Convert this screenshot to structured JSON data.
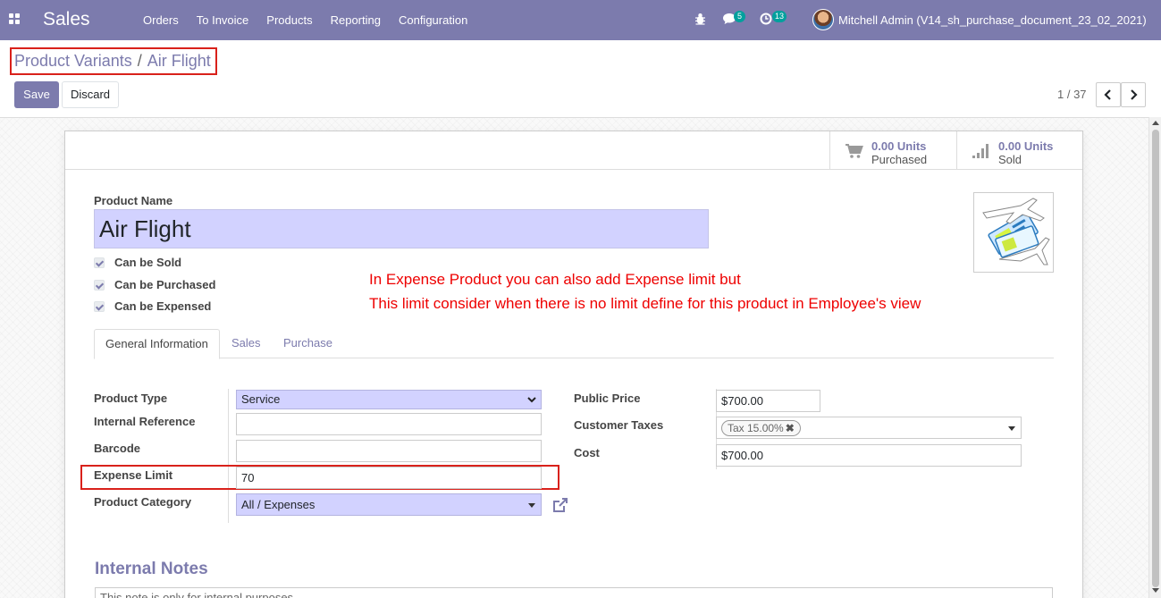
{
  "navbar": {
    "brand": "Sales",
    "menu": [
      "Orders",
      "To Invoice",
      "Products",
      "Reporting",
      "Configuration"
    ],
    "messages_badge": "5",
    "activities_badge": "13",
    "user_name": "Mitchell Admin (V14_sh_purchase_document_23_02_2021)",
    "icons": [
      "apps-grid-icon",
      "bug-icon",
      "chat-icon",
      "clock-icon"
    ]
  },
  "control_panel": {
    "breadcrumb_parent": "Product Variants",
    "breadcrumb_separator": "/",
    "breadcrumb_current": "Air Flight",
    "save_label": "Save",
    "discard_label": "Discard",
    "pager": "1 / 37",
    "prev_icon": "‹",
    "next_icon": "›"
  },
  "stat_buttons": [
    {
      "value": "0.00 Units",
      "label": "Purchased",
      "icon": "cart-icon"
    },
    {
      "value": "0.00 Units",
      "label": "Sold",
      "icon": "bar-chart-icon"
    }
  ],
  "form": {
    "product_name_label": "Product Name",
    "product_name": "Air Flight",
    "checkboxes": [
      {
        "label": "Can be Sold",
        "checked": true
      },
      {
        "label": "Can be Purchased",
        "checked": true
      },
      {
        "label": "Can be Expensed",
        "checked": true
      }
    ],
    "annotation_line1": "In Expense Product you can also add Expense limit but",
    "annotation_line2": "This limit consider when there is no limit define for this product in Employee's view",
    "tabs": [
      "General Information",
      "Sales",
      "Purchase"
    ],
    "active_tab": "General Information",
    "left_group": {
      "product_type_label": "Product Type",
      "product_type": "Service",
      "internal_reference_label": "Internal Reference",
      "internal_reference": "",
      "barcode_label": "Barcode",
      "barcode": "",
      "expense_limit_label": "Expense Limit",
      "expense_limit": "70",
      "product_category_label": "Product Category",
      "product_category": "All / Expenses"
    },
    "right_group": {
      "public_price_label": "Public Price",
      "public_price": "$700.00",
      "customer_taxes_label": "Customer Taxes",
      "customer_tax_tag": "Tax 15.00%",
      "cost_label": "Cost",
      "cost": "$700.00"
    },
    "internal_notes_title": "Internal Notes",
    "internal_notes_placeholder": "This note is only for internal purposes."
  },
  "colors": {
    "brand": "#7c7bad",
    "required_field": "#d2d2ff",
    "annotation": "#ee0000",
    "highlight_border": "#d9211b"
  }
}
